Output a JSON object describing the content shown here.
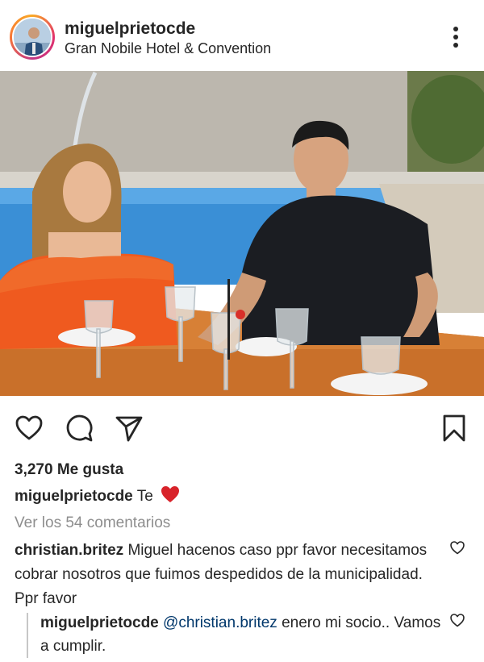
{
  "post": {
    "username": "miguelprietocde",
    "location": "Gran Nobile Hotel & Convention",
    "avatar_icon": "profile-photo",
    "more_icon": "three-dots-vertical-icon"
  },
  "actions": {
    "like_icon": "heart-outline-icon",
    "comment_icon": "comment-bubble-icon",
    "share_icon": "paper-plane-icon",
    "save_icon": "bookmark-icon"
  },
  "likes": {
    "count_text": "3,270 Me gusta"
  },
  "caption": {
    "username": "miguelprietocde",
    "text": "Te",
    "emoji_icon": "red-heart-emoji"
  },
  "view_comments": "Ver los 54 comentarios",
  "comments": [
    {
      "username": "christian.britez",
      "text": "Miguel hacenos caso ppr favor necesitamos cobrar nosotros que fuimos despedidos de la municipalidad. Ppr favor"
    }
  ],
  "reply": {
    "username": "miguelprietocde",
    "mention": "@christian.britez",
    "text": "enero mi socio.. Vamos a cumplir."
  },
  "colors": {
    "text": "#262626",
    "muted": "#8e8e8e",
    "mention": "#00376b",
    "heart": "#ed4956"
  }
}
